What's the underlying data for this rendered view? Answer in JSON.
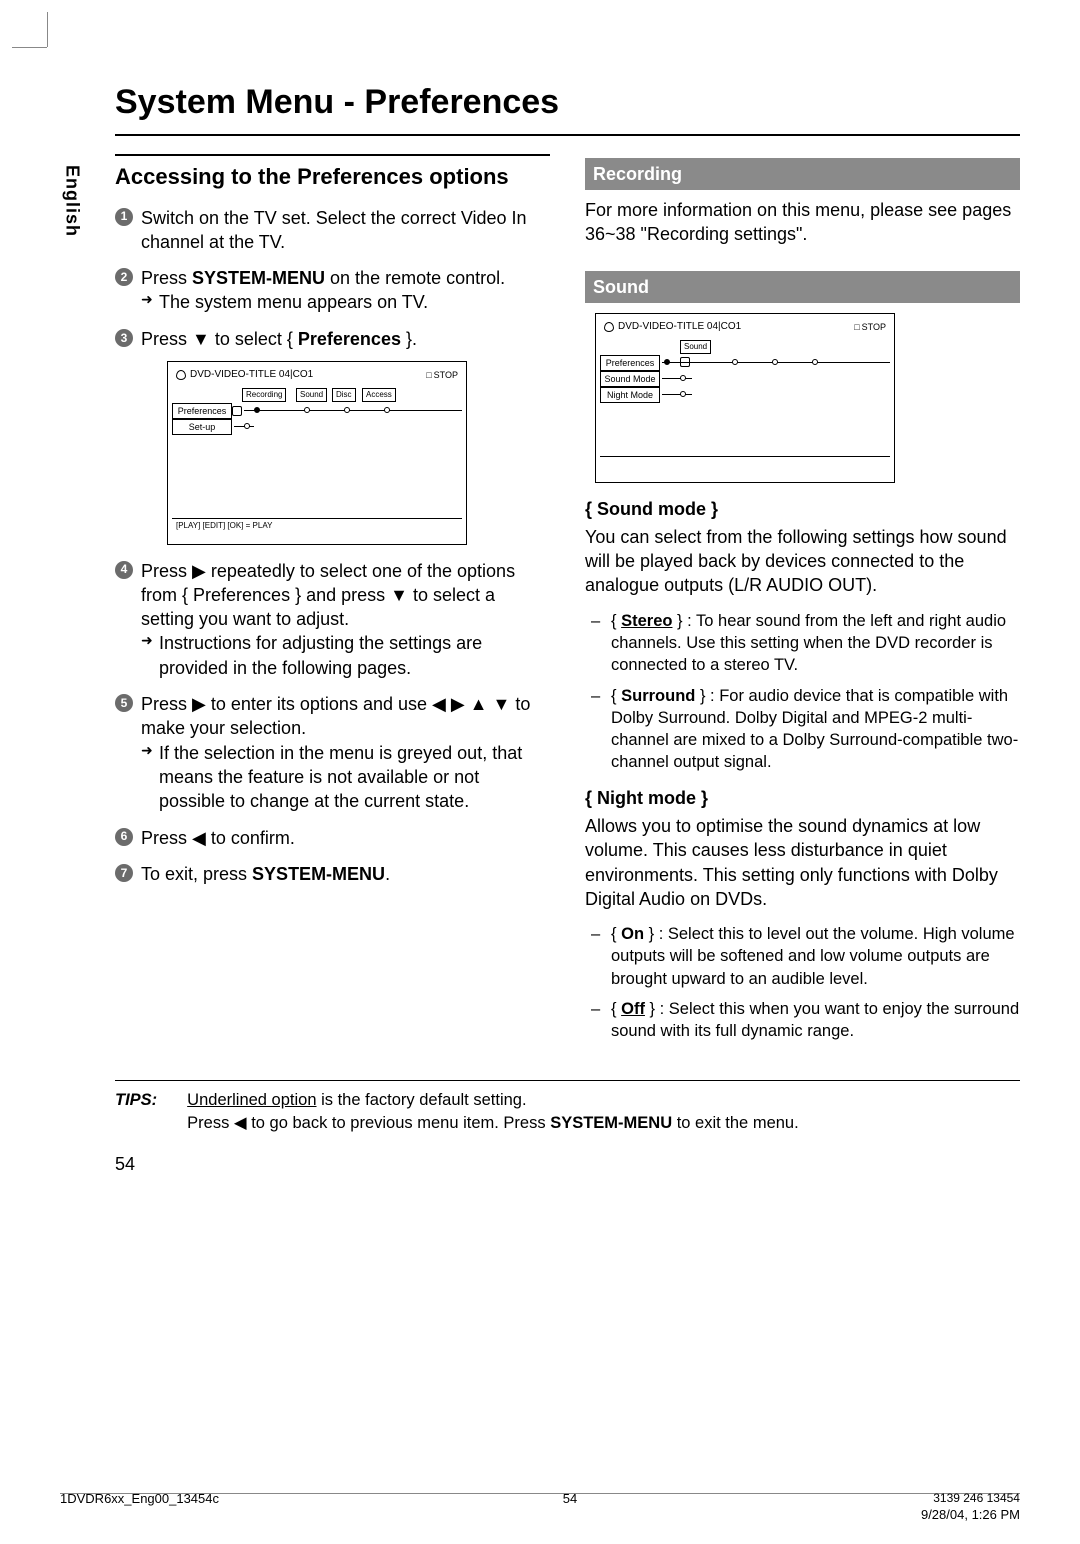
{
  "language_tab": "English",
  "page_title": "System Menu - Preferences",
  "left": {
    "section_title": "Accessing to the Preferences options",
    "steps": {
      "s1": "Switch on the TV set.  Select the correct Video In channel at the TV.",
      "s2a": "Press ",
      "s2b": "SYSTEM-MENU",
      "s2c": " on the remote control.",
      "s2sub": "The system menu appears on TV.",
      "s3a": "Press ▼ to select { ",
      "s3b": "Preferences",
      "s3c": " }.",
      "s4a": "Press ▶ repeatedly to select one of the options from { Preferences } and press ▼ to select a setting you want to adjust.",
      "s4sub": "Instructions for adjusting the settings are provided in the following pages.",
      "s5a": "Press ▶ to enter its options and use ◀ ▶ ▲ ▼  to make your selection.",
      "s5sub": "If the selection in the menu is greyed out, that means the feature is not available or not possible to change at the current state.",
      "s6": "Press ◀ to confirm.",
      "s7a": "To exit, press ",
      "s7b": "SYSTEM-MENU",
      "s7c": "."
    },
    "osd": {
      "title": "DVD-VIDEO-TITLE 04|CO1",
      "stop": "STOP",
      "tabs": [
        "Recording",
        "Sound",
        "Disc",
        "Access"
      ],
      "row1": "Preferences",
      "row2": "Set-up",
      "footer": "[PLAY] [EDIT] [OK] = PLAY"
    }
  },
  "right": {
    "recording": {
      "bar": "Recording",
      "text": "For more information on this menu, please see pages 36~38 \"Recording settings\"."
    },
    "sound": {
      "bar": "Sound",
      "osd": {
        "title": "DVD-VIDEO-TITLE 04|CO1",
        "stop": "STOP",
        "tab": "Sound",
        "row1": "Preferences",
        "row2": "Sound Mode",
        "row3": "Night Mode"
      },
      "sound_mode_heading": "{ Sound mode }",
      "sound_mode_text": "You can select from the following settings how sound will be played back by devices connected to the analogue outputs (L/R AUDIO OUT).",
      "stereo_label": "Stereo",
      "stereo_text": " } : To hear sound from the left and right audio channels. Use this setting when the DVD recorder is connected to a stereo TV.",
      "surround_label": "Surround",
      "surround_text": " } : For audio device that is compatible with Dolby Surround.  Dolby Digital and MPEG-2 multi-channel are mixed to a Dolby Surround-compatible two-channel output signal.",
      "night_mode_heading": "{ Night mode }",
      "night_mode_text": "Allows you to optimise the sound dynamics at low volume.  This causes less disturbance in quiet environments.  This setting only functions with Dolby Digital Audio on DVDs.",
      "on_label": "On",
      "on_text": " } : Select this to level out the volume. High volume outputs will be softened and low volume outputs are brought upward to an audible level.",
      "off_label": "Off",
      "off_text": " } : Select this when you want to enjoy the surround sound with its full dynamic range."
    }
  },
  "tips": {
    "label": "TIPS:",
    "line1a": "Underlined option",
    "line1b": " is the factory default setting.",
    "line2a": "Press ◀ to go back to previous menu item.  Press ",
    "line2b": "SYSTEM-MENU",
    "line2c": " to exit the menu."
  },
  "page_number": "54",
  "footer": {
    "left": "1DVDR6xx_Eng00_13454c",
    "center": "54",
    "right_date": "9/28/04, 1:26 PM",
    "right_code": "3139 246 13454"
  }
}
